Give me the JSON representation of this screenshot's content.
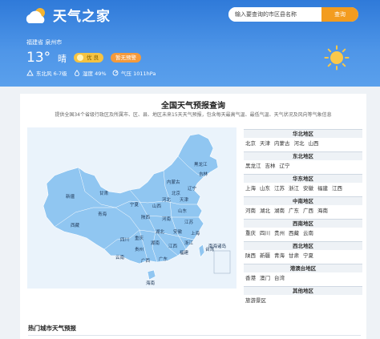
{
  "header": {
    "logo_text": "天气之家",
    "search_placeholder": "输入要查询的市区县名称",
    "search_button": "查询"
  },
  "current": {
    "location": "福建省 泉州市",
    "temperature": "13°",
    "condition": "晴",
    "aqi": "优 良",
    "warning": "暂无预警",
    "wind": "东北风 6-7级",
    "humidity": "湿度 49%",
    "pressure": "气压 1011hPa"
  },
  "card": {
    "title": "全国天气预报查询",
    "subtitle": "提供全国34个省级行政区及所属市、区、县、地区未来15天天气预报，包含每天最高气温、最低气温、天气状况及风向等气象信息"
  },
  "regions": [
    {
      "name": "华北地区",
      "items": [
        "北京",
        "天津",
        "内蒙古",
        "河北",
        "山西"
      ]
    },
    {
      "name": "东北地区",
      "items": [
        "黑龙江",
        "吉林",
        "辽宁"
      ]
    },
    {
      "name": "华东地区",
      "items": [
        "上海",
        "山东",
        "江苏",
        "浙江",
        "安徽",
        "福建",
        "江西"
      ]
    },
    {
      "name": "中南地区",
      "items": [
        "河南",
        "湖北",
        "湖南",
        "广东",
        "广西",
        "海南"
      ]
    },
    {
      "name": "西南地区",
      "items": [
        "重庆",
        "四川",
        "贵州",
        "西藏",
        "云南"
      ]
    },
    {
      "name": "西北地区",
      "items": [
        "陕西",
        "新疆",
        "青海",
        "甘肃",
        "宁夏"
      ]
    },
    {
      "name": "港澳台地区",
      "items": [
        "香港",
        "澳门",
        "台湾"
      ]
    },
    {
      "name": "其他地区",
      "items": [
        "旅游景区"
      ]
    }
  ],
  "map_labels": {
    "heilongjiang": "黑龙江",
    "jilin": "吉林",
    "neimenggu": "内蒙古",
    "liaoning": "辽宁",
    "xinjiang": "新疆",
    "xizang": "西藏",
    "qinghai": "青海",
    "gansu": "甘肃",
    "ningxia": "宁夏",
    "shanxi": "山西",
    "shaanxi": "陕西",
    "hebei": "河北",
    "beijing": "北京",
    "tianjin": "天津",
    "shandong": "山东",
    "henan": "河南",
    "jiangsu": "江苏",
    "anhui": "安徽",
    "shanghai": "上海",
    "hubei": "湖北",
    "sichuan": "四川",
    "chongqing": "重庆",
    "zhejiang": "浙江",
    "hunan": "湖南",
    "jiangxi": "江西",
    "guizhou": "贵州",
    "fujian": "福建",
    "yunnan": "云南",
    "guangxi": "广西",
    "guangdong": "广东",
    "taiwan": "台湾",
    "hainan": "海南",
    "south_sea": "南海诸岛"
  },
  "hot": {
    "title": "热门城市天气预报"
  },
  "colors": {
    "accent": "#f39c1f",
    "header": "#3d88e0",
    "map": "#90c6f1"
  }
}
